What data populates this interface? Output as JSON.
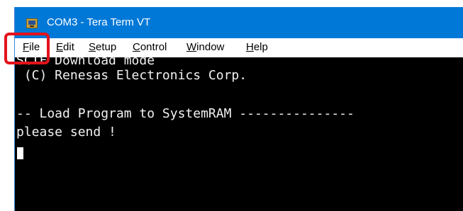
{
  "window": {
    "title": "COM3 - Tera Term VT",
    "icon": "tera-term-app-icon"
  },
  "menu": {
    "items": [
      {
        "label": "File"
      },
      {
        "label": "Edit"
      },
      {
        "label": "Setup"
      },
      {
        "label": "Control"
      },
      {
        "label": "Window"
      },
      {
        "label": "Help"
      }
    ]
  },
  "terminal": {
    "lines": [
      "SCIF Download mode",
      " (C) Renesas Electronics Corp.",
      "",
      "-- Load Program to SystemRAM ---------------",
      "please send !"
    ],
    "background": "#000000",
    "foreground": "#f2f2f2"
  },
  "highlight": {
    "target": "file-menu",
    "color": "#e3121b"
  }
}
